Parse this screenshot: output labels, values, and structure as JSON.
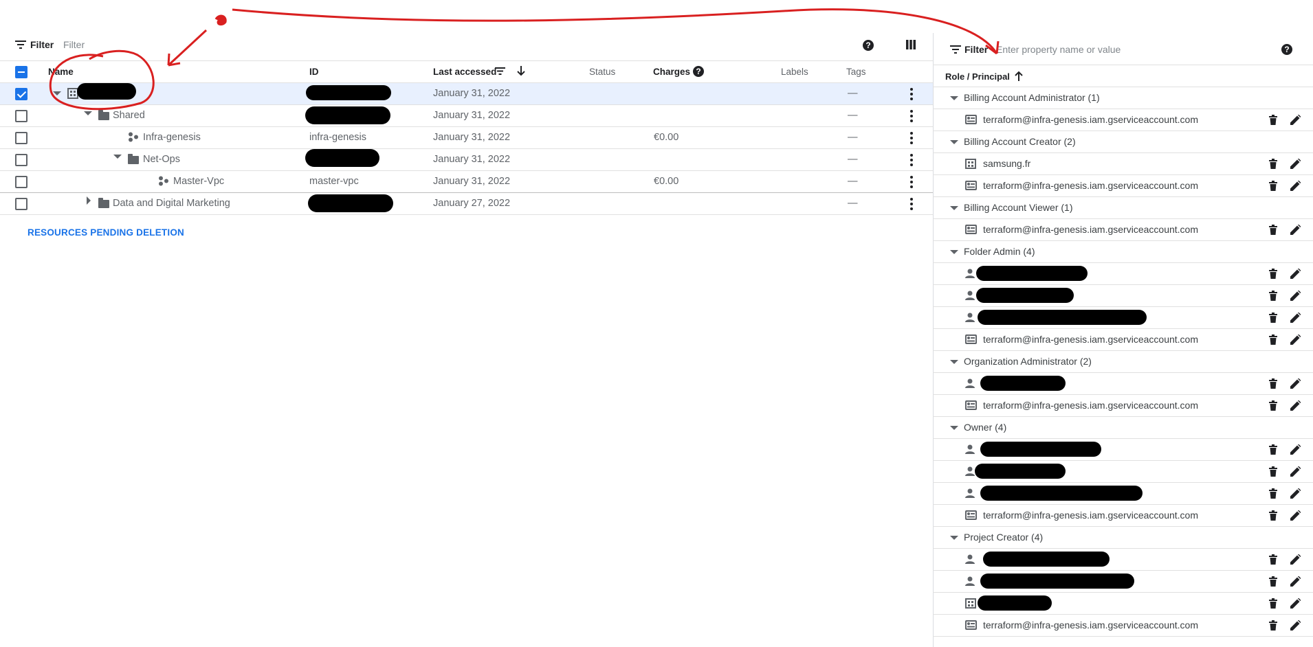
{
  "toolbar": {
    "filter_label": "Filter",
    "filter_placeholder": "Filter"
  },
  "table": {
    "headers": {
      "name": "Name",
      "id": "ID",
      "last_accessed": "Last accessed",
      "status": "Status",
      "charges": "Charges",
      "labels": "Labels",
      "tags": "Tags"
    },
    "rows": [
      {
        "name": "",
        "id": "",
        "last_accessed": "January 31, 2022",
        "charges": "",
        "tags": "—"
      },
      {
        "name": "Shared",
        "id": "",
        "last_accessed": "January 31, 2022",
        "charges": "",
        "tags": "—"
      },
      {
        "name": "Infra-genesis",
        "id": "infra-genesis",
        "last_accessed": "January 31, 2022",
        "charges": "€0.00",
        "tags": "—"
      },
      {
        "name": "Net-Ops",
        "id": "",
        "last_accessed": "January 31, 2022",
        "charges": "",
        "tags": "—"
      },
      {
        "name": "Master-Vpc",
        "id": "master-vpc",
        "last_accessed": "January 31, 2022",
        "charges": "€0.00",
        "tags": "—"
      },
      {
        "name": "Data and Digital Marketing",
        "id": "",
        "last_accessed": "January 27, 2022",
        "charges": "",
        "tags": "—"
      }
    ]
  },
  "pending_link": "RESOURCES PENDING DELETION",
  "panel": {
    "filter_label": "Filter",
    "filter_placeholder": "Enter property name or value",
    "column_header": "Role / Principal",
    "groups": [
      {
        "role": "Billing Account Administrator (1)",
        "principals": [
          "terraform@infra-genesis.iam.gserviceaccount.com"
        ]
      },
      {
        "role": "Billing Account Creator (2)",
        "principals": [
          "samsung.fr",
          "terraform@infra-genesis.iam.gserviceaccount.com"
        ]
      },
      {
        "role": "Billing Account Viewer (1)",
        "principals": [
          "terraform@infra-genesis.iam.gserviceaccount.com"
        ]
      },
      {
        "role": "Folder Admin (4)",
        "principals": [
          "",
          "",
          "",
          "terraform@infra-genesis.iam.gserviceaccount.com"
        ]
      },
      {
        "role": "Organization Administrator (2)",
        "principals": [
          "",
          "terraform@infra-genesis.iam.gserviceaccount.com"
        ]
      },
      {
        "role": "Owner (4)",
        "principals": [
          "",
          "",
          "",
          "terraform@infra-genesis.iam.gserviceaccount.com"
        ]
      },
      {
        "role": "Project Creator (4)",
        "principals": [
          "",
          "",
          "",
          "terraform@infra-genesis.iam.gserviceaccount.com"
        ]
      }
    ]
  },
  "colors": {
    "accent": "#1a73e8",
    "annotation": "#d92020"
  }
}
